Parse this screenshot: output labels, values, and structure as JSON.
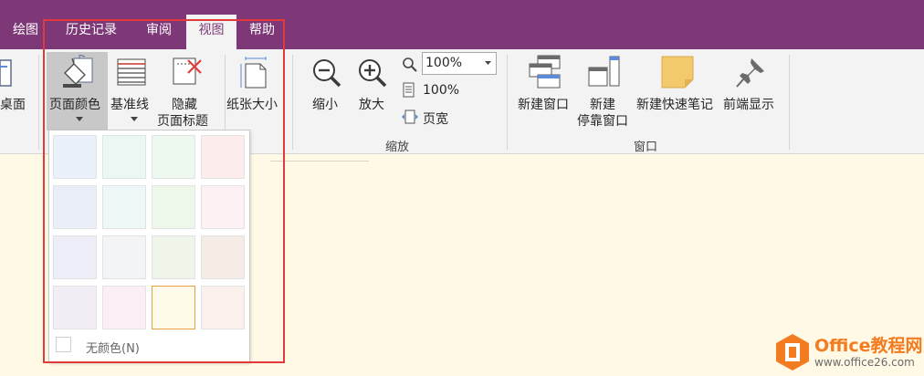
{
  "tabs": [
    {
      "label": "绘图",
      "active": false
    },
    {
      "label": "历史记录",
      "active": false
    },
    {
      "label": "审阅",
      "active": false
    },
    {
      "label": "视图",
      "active": true
    },
    {
      "label": "帮助",
      "active": false
    }
  ],
  "ribbon": {
    "desktop_label": "桌面",
    "page_color_label": "页面颜色",
    "rule_lines_label": "基准线",
    "hide_title_line1": "隐藏",
    "hide_title_line2": "页面标题",
    "paper_size_label": "纸张大小",
    "zoom_out_label": "缩小",
    "zoom_in_label": "放大",
    "zoom_value": "100%",
    "zoom_100_label": "100%",
    "page_width_label": "页宽",
    "zoom_group_label": "缩放",
    "new_window_label": "新建窗口",
    "new_docked_line1": "新建",
    "new_docked_line2": "停靠窗口",
    "new_quick_note_label": "新建快速笔记",
    "always_on_top_label": "前端显示",
    "window_group_label": "窗口"
  },
  "page_color_menu": {
    "no_color_label": "无颜色(N)",
    "swatches": [
      "#eaf1fb",
      "#eaf7f3",
      "#edf8ef",
      "#fcecec",
      "#eaeef9",
      "#eef8f8",
      "#eef8ea",
      "#fdf1f4",
      "#eeeef8",
      "#f2f4f6",
      "#f0f5ea",
      "#f6ece6",
      "#f3eef6",
      "#fbeef6",
      "#fffbeb",
      "#fbf1ec"
    ],
    "selected_index": 14
  },
  "watermark": {
    "brand": "Office教程网",
    "url": "www.office26.com"
  },
  "colors": {
    "tab_bar": "#7e3878",
    "canvas": "#fff9e5",
    "highlight": "#e23a3a"
  }
}
